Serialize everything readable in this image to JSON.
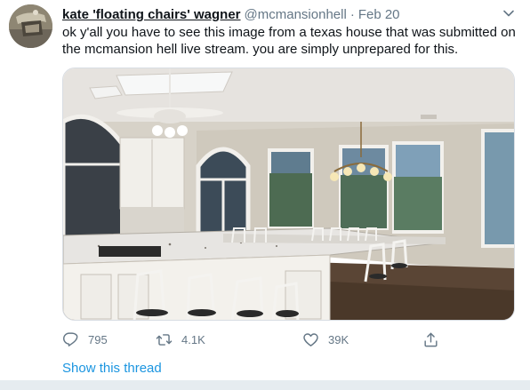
{
  "tweet": {
    "display_name": "kate 'floating chairs' wagner",
    "handle": "@mcmansionhell",
    "separator": "·",
    "date": "Feb 20",
    "text": "ok y'all you have to see this image from a texas house that was submitted on the mcmansion hell live stream. you are simply unprepared for this.",
    "media": {
      "description_icon": "photo-kitchen-image"
    },
    "actions": {
      "reply_count": "795",
      "retweet_count": "4.1K",
      "like_count": "39K"
    },
    "show_thread": "Show this thread"
  },
  "colors": {
    "link_blue": "#1b95e0",
    "muted_gray": "#657786",
    "text_dark": "#0f1419"
  }
}
